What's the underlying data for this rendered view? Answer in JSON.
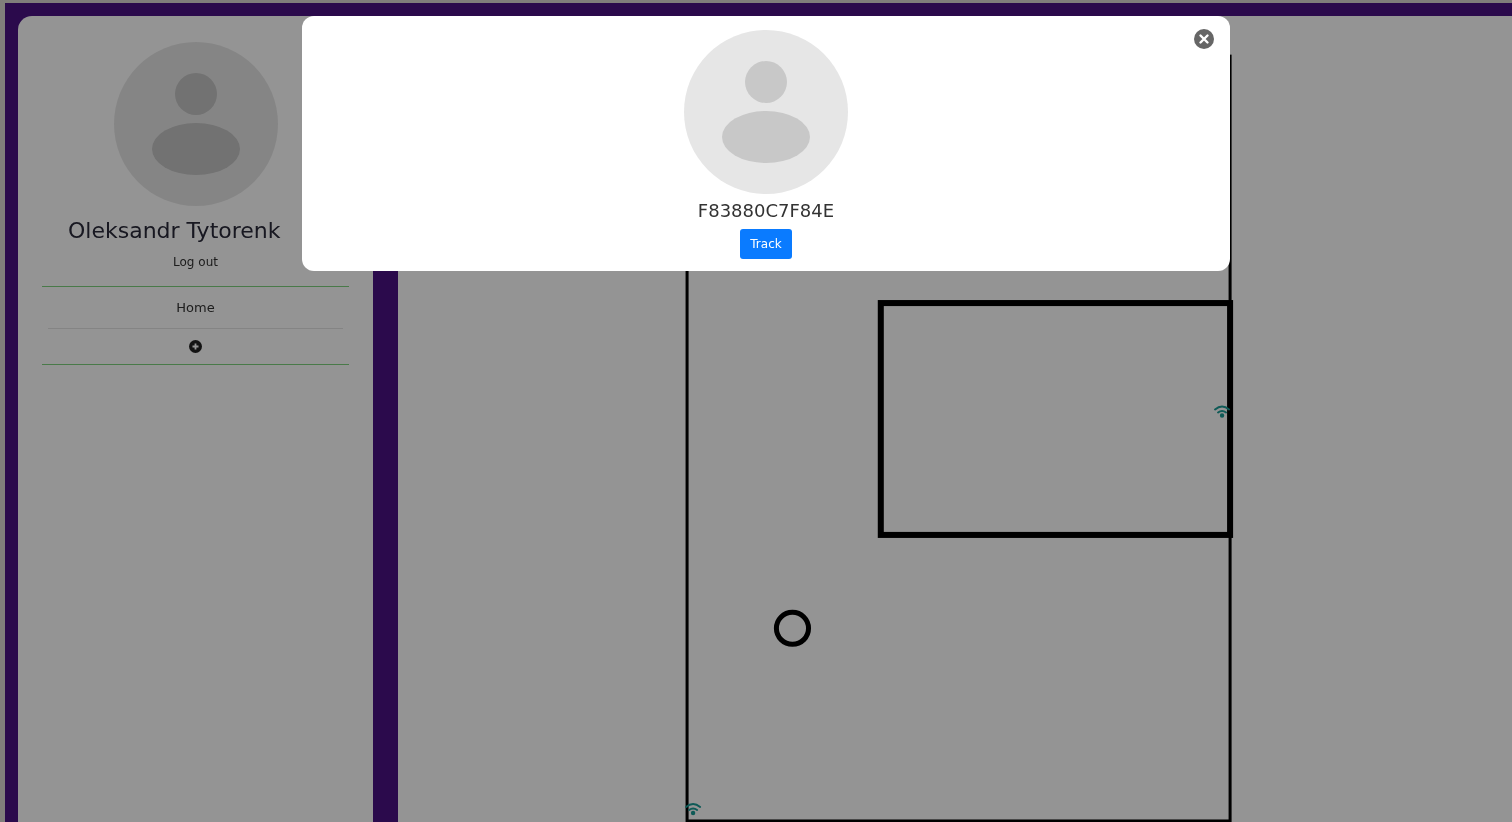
{
  "sidebar": {
    "user_name": "Oleksandr Tytorenk",
    "logout": "Log out",
    "nav_items": [
      {
        "label": "Home"
      }
    ]
  },
  "modal": {
    "device_id": "F83880C7F84E",
    "button": "Track"
  }
}
